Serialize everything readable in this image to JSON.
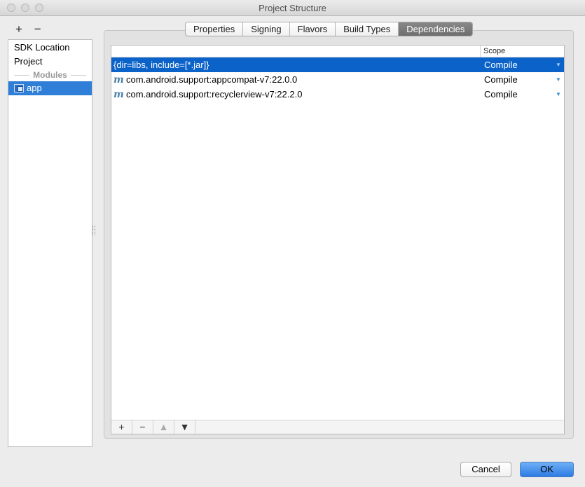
{
  "window": {
    "title": "Project Structure"
  },
  "sidebar": {
    "tools": {
      "add": "+",
      "remove": "−"
    },
    "items": [
      {
        "label": "SDK Location"
      },
      {
        "label": "Project"
      }
    ],
    "section_label": "Modules",
    "modules": [
      {
        "label": "app",
        "selected": true
      }
    ]
  },
  "tabs": [
    {
      "label": "Properties",
      "active": false
    },
    {
      "label": "Signing",
      "active": false
    },
    {
      "label": "Flavors",
      "active": false
    },
    {
      "label": "Build Types",
      "active": false
    },
    {
      "label": "Dependencies",
      "active": true
    }
  ],
  "dependencies": {
    "columns": {
      "name": "",
      "scope": "Scope"
    },
    "rows": [
      {
        "name": "{dir=libs, include=[*.jar]}",
        "scope": "Compile",
        "icon": "",
        "selected": true
      },
      {
        "name": "com.android.support:appcompat-v7:22.0.0",
        "scope": "Compile",
        "icon": "maven-m-icon",
        "selected": false
      },
      {
        "name": "com.android.support:recyclerview-v7:22.2.0",
        "scope": "Compile",
        "icon": "maven-m-icon",
        "selected": false
      }
    ],
    "toolbar": {
      "add": "+",
      "remove": "−",
      "up": "▲",
      "down": "▼"
    }
  },
  "buttons": {
    "cancel": "Cancel",
    "ok": "OK"
  },
  "colors": {
    "selection": "#0b62c9",
    "sidebar_selection": "#2f7fd8",
    "primary_button": "#2d7ae4"
  }
}
